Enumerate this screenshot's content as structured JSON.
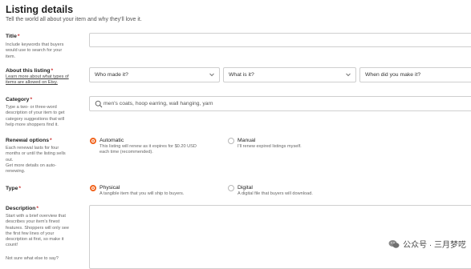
{
  "header": {
    "title": "Listing details",
    "subtitle": "Tell the world all about your item and why they'll love it."
  },
  "title_field": {
    "label": "Title",
    "required_mark": "*",
    "help": [
      "Include keywords that buyers",
      "would use to search for your",
      "item."
    ],
    "value": ""
  },
  "about": {
    "label": "About this listing",
    "required_mark": "*",
    "help_link": [
      "Learn more about what types of",
      "items are allowed on Etsy."
    ],
    "selects": [
      {
        "label": "Who made it?"
      },
      {
        "label": "What is it?"
      },
      {
        "label": "When did you make it?"
      }
    ]
  },
  "category": {
    "label": "Category",
    "required_mark": "*",
    "help": [
      "Type a two- or three-word",
      "description of your item to get",
      "category suggestions that will",
      "help more shoppers find it."
    ],
    "placeholder": "men's coats, hoop earring, wall hanging, yarn"
  },
  "renewal": {
    "label": "Renewal options",
    "required_mark": "*",
    "help": [
      "Each renewal lasts for four",
      "months or until the listing sells",
      "out.",
      "Get more details on auto-",
      "renewing."
    ],
    "options": [
      {
        "title": "Automatic",
        "desc": [
          "This listing will renew as it expires for $0.20 USD",
          "each time (recommended)."
        ],
        "selected": true
      },
      {
        "title": "Manual",
        "desc": [
          "I'll renew expired listings myself."
        ],
        "selected": false
      }
    ]
  },
  "type": {
    "label": "Type",
    "required_mark": "*",
    "options": [
      {
        "title": "Physical",
        "desc": "A tangible item that you will ship to buyers.",
        "selected": true
      },
      {
        "title": "Digital",
        "desc": "A digital file that buyers will download.",
        "selected": false
      }
    ]
  },
  "description": {
    "label": "Description",
    "required_mark": "*",
    "help": [
      "Start with a brief overview that",
      "describes your item's finest",
      "features. Shoppers will only see",
      "the first few lines of your",
      "description at first, so make it",
      "count!"
    ],
    "help2": "Not sure what else to say?",
    "value": ""
  },
  "watermark": {
    "text": "公众号 · 三月梦呓"
  },
  "colors": {
    "accent": "#f1641e",
    "border": "#cfcfcf"
  },
  "icons": {
    "search": "search-icon",
    "chevron": "chevron-down-icon",
    "wechat": "wechat-icon"
  }
}
